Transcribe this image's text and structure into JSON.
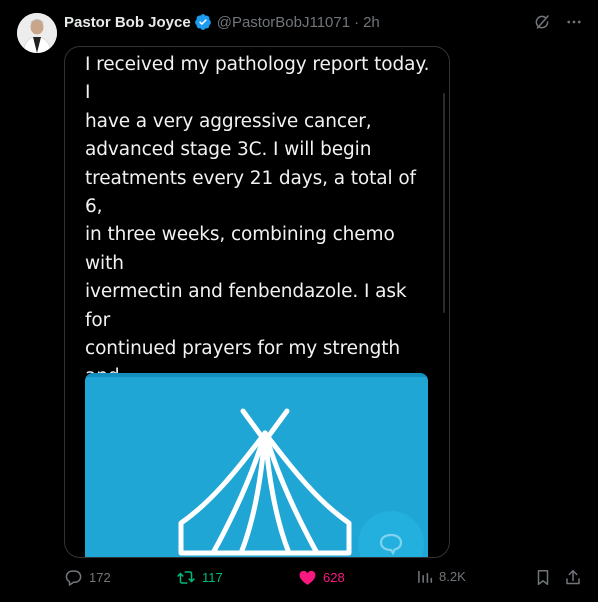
{
  "post": {
    "author": {
      "display_name": "Pastor Bob Joyce",
      "handle": "@PastorBobJ11071",
      "separator": "·",
      "time": "2h",
      "verified": true
    },
    "image_text": "I received my pathology report today. I\nhave a very aggressive cancer,\nadvanced stage 3C. I will begin\ntreatments every 21 days, a total of 6,\nin three weeks, combining chemo with\nivermectin and fenbendazole. I ask for\ncontinued prayers for my strength and\nhealing. I also ask that medbeds be\noffered to critically ill anons like\nmyself who have faithfully followed\nChrist’s path.",
    "metrics": {
      "replies": "172",
      "reposts": "117",
      "likes": "628",
      "views": "8.2K"
    }
  },
  "icons": {
    "verified": "verified-badge-icon",
    "grok": "grok-icon",
    "more": "more-icon",
    "reply": "reply-icon",
    "repost": "repost-icon",
    "like": "heart-icon",
    "views": "views-icon",
    "bookmark": "bookmark-icon",
    "share": "share-icon",
    "tent": "tent-icon",
    "chat": "chat-bubble-icon"
  },
  "colors": {
    "background": "#000000",
    "text_primary": "#e7e9ea",
    "text_secondary": "#71767b",
    "verified_blue": "#1d9bf0",
    "repost_green": "#00ba7c",
    "like_pink": "#f91880",
    "card_blue": "#1fa6d4"
  }
}
